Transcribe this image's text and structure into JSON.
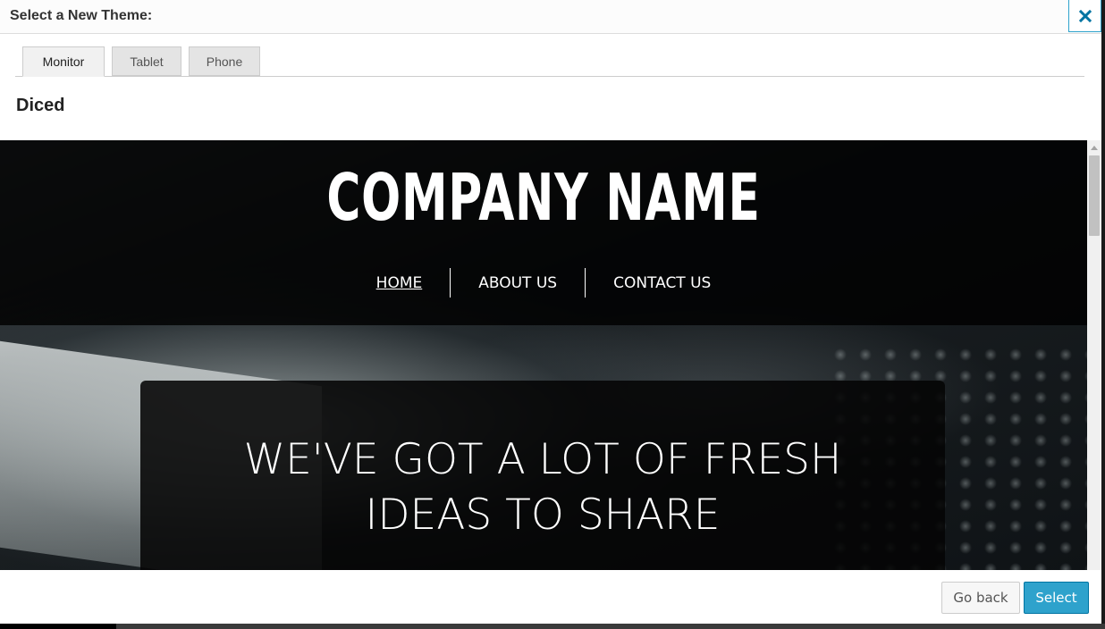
{
  "dialog": {
    "title": "Select a New Theme:",
    "close_icon": "close-x-icon",
    "accent_color": "#0074a2"
  },
  "tabs": [
    {
      "label": "Monitor",
      "active": true
    },
    {
      "label": "Tablet",
      "active": false
    },
    {
      "label": "Phone",
      "active": false
    }
  ],
  "theme_name": "Diced",
  "preview": {
    "company_name": "COMPANY NAME",
    "nav": [
      {
        "label": "HOME",
        "current": true
      },
      {
        "label": "ABOUT US",
        "current": false
      },
      {
        "label": "CONTACT US",
        "current": false
      }
    ],
    "hero_line1": "WE'VE GOT A LOT OF FRESH",
    "hero_line2": "IDEAS TO SHARE"
  },
  "footer": {
    "back_label": "Go back",
    "select_label": "Select",
    "select_color": "#2ea2cc"
  }
}
